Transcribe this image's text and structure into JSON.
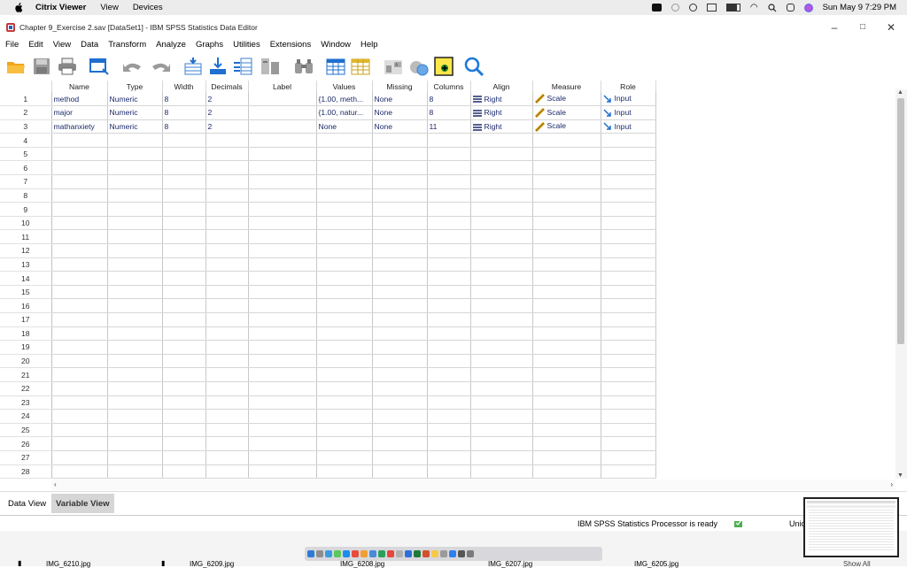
{
  "mac_menubar": {
    "app_name": "Citrix Viewer",
    "menus": [
      "View",
      "Devices"
    ],
    "clock": "Sun May 9  7:29 PM"
  },
  "window": {
    "title": "Chapter 9_Exercise 2.sav [DataSet1] - IBM SPSS Statistics Data Editor",
    "minimize": "–",
    "maximize": "□",
    "close": "✕"
  },
  "menu": [
    "File",
    "Edit",
    "View",
    "Data",
    "Transform",
    "Analyze",
    "Graphs",
    "Utilities",
    "Extensions",
    "Window",
    "Help"
  ],
  "toolbar_icons": [
    "open-folder-icon",
    "save-icon",
    "print-icon",
    "recall-dialog-icon",
    "undo-icon",
    "redo-icon",
    "goto-case-icon",
    "goto-variable-icon",
    "variables-icon",
    "run-descriptives-icon",
    "find-icon",
    "insert-cases-icon",
    "insert-variable-icon",
    "split-file-icon",
    "weight-cases-icon",
    "select-cases-icon",
    "value-labels-icon",
    "search-icon"
  ],
  "columns": [
    "",
    "Name",
    "Type",
    "Width",
    "Decimals",
    "Label",
    "Values",
    "Missing",
    "Columns",
    "Align",
    "Measure",
    "Role"
  ],
  "rows": [
    {
      "num": "1",
      "name": "method",
      "type": "Numeric",
      "width": "8",
      "decimals": "2",
      "label": "",
      "values": "{1.00, meth...",
      "missing": "None",
      "columns": "8",
      "align": "Right",
      "measure": "Scale",
      "role": "Input"
    },
    {
      "num": "2",
      "name": "major",
      "type": "Numeric",
      "width": "8",
      "decimals": "2",
      "label": "",
      "values": "{1.00, natur...",
      "missing": "None",
      "columns": "8",
      "align": "Right",
      "measure": "Scale",
      "role": "Input"
    },
    {
      "num": "3",
      "name": "mathanxiety",
      "type": "Numeric",
      "width": "8",
      "decimals": "2",
      "label": "",
      "values": "None",
      "missing": "None",
      "columns": "11",
      "align": "Right",
      "measure": "Scale",
      "role": "Input"
    }
  ],
  "empty_row_numbers": [
    "4",
    "5",
    "6",
    "7",
    "8",
    "9",
    "10",
    "11",
    "12",
    "13",
    "14",
    "15",
    "16",
    "17",
    "18",
    "19",
    "20",
    "21",
    "22",
    "23",
    "24",
    "25",
    "26",
    "27",
    "28"
  ],
  "tabs": {
    "data_view": "Data View",
    "variable_view": "Variable View"
  },
  "status": {
    "processor": "IBM SPSS Statistics Processor is ready",
    "unicode": "Unic"
  },
  "taskbar": {
    "item1": "IMG_6210.jpg",
    "item2": "IMG_6209.jpg",
    "item3": "IMG_6208.jpg",
    "item4": "IMG_6207.jpg",
    "item5": "IMG_6205.jpg",
    "show_all": "Show All"
  },
  "colors": {
    "accent": "#1e7ad8",
    "grid_text": "#1b2a6b",
    "active_tab": "#d6d6d6"
  }
}
